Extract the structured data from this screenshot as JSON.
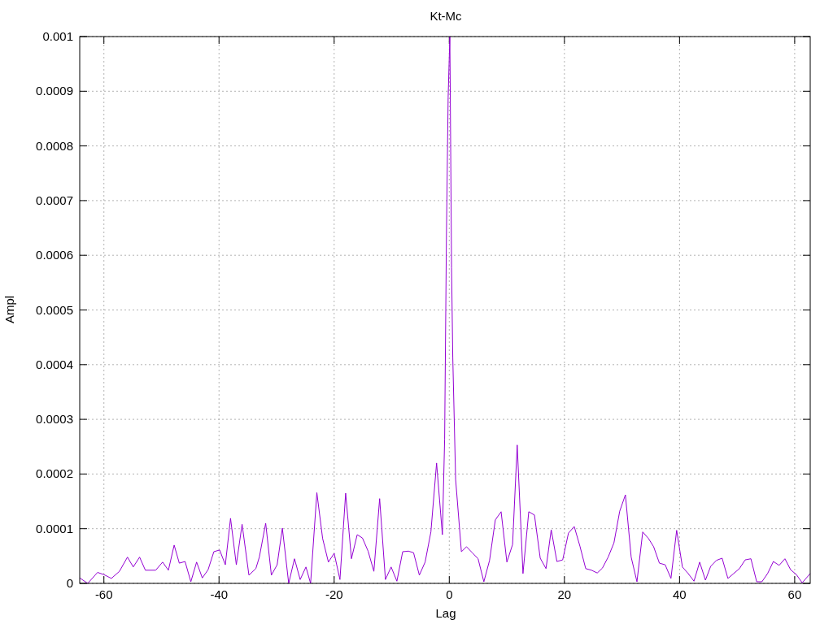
{
  "chart": {
    "chart_data": {
      "type": "line",
      "title": "Kt-Mc",
      "xlabel": "Lag",
      "ylabel": "Ampl",
      "x": [
        -64.2,
        -62.8,
        -61.1,
        -60,
        -58.7,
        -57.3,
        -55.9,
        -54.9,
        -53.8,
        -52.8,
        -51.0,
        -49.8,
        -48.8,
        -47.8,
        -46.9,
        -45.9,
        -44.9,
        -43.9,
        -42.9,
        -41.9,
        -40.9,
        -39.9,
        -38.9,
        -38.0,
        -37.0,
        -36.0,
        -34.8,
        -33.6,
        -33.0,
        -31.9,
        -30.9,
        -29.9,
        -29.0,
        -27.9,
        -26.9,
        -25.9,
        -24.9,
        -24.1,
        -23.0,
        -22.0,
        -21.0,
        -20.0,
        -19.0,
        -18.0,
        -17.0,
        -16.0,
        -15.1,
        -14.1,
        -13.1,
        -12.1,
        -11.1,
        -10.1,
        -9.1,
        -8.1,
        -7.1,
        -6.2,
        -5.2,
        -4.2,
        -3.2,
        -2.2,
        -1.2,
        -0.8,
        -0.5,
        -0.2,
        0.1,
        0.4,
        0.6,
        1.1,
        2.1,
        3.0,
        4.0,
        5.0,
        6.0,
        7.0,
        8.0,
        9.0,
        10.0,
        11.0,
        11.8,
        12.8,
        13.8,
        14.8,
        15.8,
        16.8,
        17.7,
        18.7,
        19.7,
        20.7,
        21.7,
        22.7,
        23.7,
        24.7,
        25.7,
        26.6,
        27.6,
        28.6,
        29.6,
        30.6,
        31.6,
        32.6,
        33.6,
        34.6,
        35.5,
        36.5,
        37.5,
        38.5,
        39.5,
        40.5,
        41.5,
        42.5,
        43.5,
        44.5,
        45.4,
        46.4,
        47.4,
        48.4,
        49.4,
        50.4,
        51.4,
        52.4,
        53.4,
        54.3,
        55.3,
        56.3,
        57.3,
        58.3,
        59.3,
        60.3,
        61.3,
        62.7
      ],
      "series": [
        {
          "color": "#9400d3",
          "values": [
            1e-05,
            0,
            2e-05,
            1.6e-05,
            9e-06,
            2.2e-05,
            4.8e-05,
            3e-05,
            4.8e-05,
            2.4e-05,
            2.4e-05,
            3.9e-05,
            2.4e-05,
            7e-05,
            3.7e-05,
            4e-05,
            3e-06,
            3.9e-05,
            1e-05,
            2.5e-05,
            5.8e-05,
            6.1e-05,
            3.4e-05,
            0.000119,
            3.4e-05,
            0.000108,
            1.5e-05,
            2.7e-05,
            4.8e-05,
            0.00011,
            1.5e-05,
            3.4e-05,
            0.000101,
            0,
            4.5e-05,
            7e-06,
            3e-05,
            0,
            0.000166,
            8.2e-05,
            3.9e-05,
            5.5e-05,
            7e-06,
            0.000165,
            4.5e-05,
            8.9e-05,
            8.3e-05,
            5.9e-05,
            2.2e-05,
            0.000155,
            7e-06,
            3e-05,
            4e-06,
            5.8e-05,
            5.9e-05,
            5.6e-05,
            1.5e-05,
            3.9e-05,
            9.4e-05,
            0.00022,
            8.9e-05,
            0.000264,
            0.000636,
            0.000889,
            0.001,
            0.000577,
            0.000413,
            0.00019,
            5.8e-05,
            6.7e-05,
            5.6e-05,
            4.5e-05,
            3e-06,
            4.2e-05,
            0.000116,
            0.000131,
            3.9e-05,
            7.1e-05,
            0.000253,
            1.8e-05,
            0.000131,
            0.000125,
            4.6e-05,
            2.7e-05,
            9.8e-05,
            4e-05,
            4.3e-05,
            9.2e-05,
            0.000104,
            6.8e-05,
            2.7e-05,
            2.4e-05,
            1.9e-05,
            2.8e-05,
            4.8e-05,
            7.4e-05,
            0.000132,
            0.000162,
            4.8e-05,
            3e-06,
            9.4e-05,
            8.2e-05,
            6.7e-05,
            3.7e-05,
            3.4e-05,
            9e-06,
            9.7e-05,
            3e-05,
            1.8e-05,
            4e-06,
            3.9e-05,
            6e-06,
            3.1e-05,
            4.2e-05,
            4.6e-05,
            9e-06,
            1.8e-05,
            2.7e-05,
            4.3e-05,
            4.5e-05,
            3e-06,
            3e-06,
            1.8e-05,
            4e-05,
            3.3e-05,
            4.5e-05,
            2.5e-05,
            1.6e-05,
            1e-06,
            1.8e-05
          ]
        }
      ],
      "grid": true,
      "xlim": [
        -64.2,
        62.7
      ],
      "ylim": [
        0,
        0.001
      ],
      "xticks": [
        -60,
        -40,
        -20,
        0,
        20,
        40,
        60
      ],
      "yticks": [
        0,
        0.0001,
        0.0002,
        0.0003,
        0.0004,
        0.0005,
        0.0006,
        0.0007,
        0.0008,
        0.0009,
        0.001
      ]
    }
  }
}
